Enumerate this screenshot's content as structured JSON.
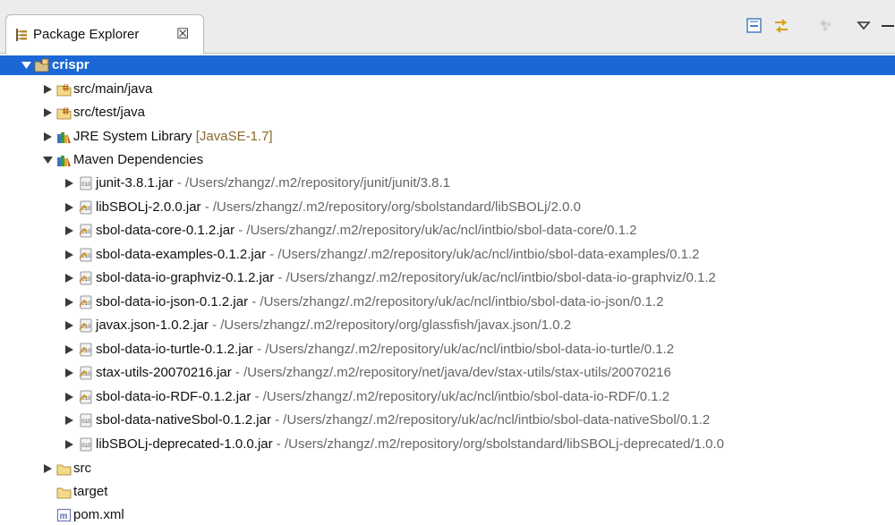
{
  "view": {
    "tab_title": "Package Explorer",
    "close_glyph": "☒"
  },
  "toolbar": {
    "icons": [
      "collapse-all-icon",
      "link-with-editor-icon",
      "focus-icon",
      "view-menu-icon",
      "minimize-icon"
    ]
  },
  "tree": {
    "project": "crispr",
    "src_main": "src/main/java",
    "src_test": "src/test/java",
    "jre_label": "JRE System Library",
    "jre_version": "[JavaSE-1.7]",
    "maven_label": "Maven Dependencies",
    "jars": [
      {
        "name": "junit-3.8.1.jar",
        "path": " - /Users/zhangz/.m2/repository/junit/junit/3.8.1",
        "icon": "binary-jar-icon"
      },
      {
        "name": "libSBOLj-2.0.0.jar",
        "path": " - /Users/zhangz/.m2/repository/org/sbolstandard/libSBOLj/2.0.0",
        "icon": "source-jar-icon"
      },
      {
        "name": "sbol-data-core-0.1.2.jar",
        "path": " - /Users/zhangz/.m2/repository/uk/ac/ncl/intbio/sbol-data-core/0.1.2",
        "icon": "source-jar-icon"
      },
      {
        "name": "sbol-data-examples-0.1.2.jar",
        "path": " - /Users/zhangz/.m2/repository/uk/ac/ncl/intbio/sbol-data-examples/0.1.2",
        "icon": "source-jar-icon"
      },
      {
        "name": "sbol-data-io-graphviz-0.1.2.jar",
        "path": " - /Users/zhangz/.m2/repository/uk/ac/ncl/intbio/sbol-data-io-graphviz/0.1.2",
        "icon": "source-jar-icon"
      },
      {
        "name": "sbol-data-io-json-0.1.2.jar",
        "path": " - /Users/zhangz/.m2/repository/uk/ac/ncl/intbio/sbol-data-io-json/0.1.2",
        "icon": "source-jar-icon"
      },
      {
        "name": "javax.json-1.0.2.jar",
        "path": " - /Users/zhangz/.m2/repository/org/glassfish/javax.json/1.0.2",
        "icon": "source-jar-icon"
      },
      {
        "name": "sbol-data-io-turtle-0.1.2.jar",
        "path": " - /Users/zhangz/.m2/repository/uk/ac/ncl/intbio/sbol-data-io-turtle/0.1.2",
        "icon": "source-jar-icon"
      },
      {
        "name": "stax-utils-20070216.jar",
        "path": " - /Users/zhangz/.m2/repository/net/java/dev/stax-utils/stax-utils/20070216",
        "icon": "source-jar-icon"
      },
      {
        "name": "sbol-data-io-RDF-0.1.2.jar",
        "path": " - /Users/zhangz/.m2/repository/uk/ac/ncl/intbio/sbol-data-io-RDF/0.1.2",
        "icon": "source-jar-icon"
      },
      {
        "name": "sbol-data-nativeSbol-0.1.2.jar",
        "path": " - /Users/zhangz/.m2/repository/uk/ac/ncl/intbio/sbol-data-nativeSbol/0.1.2",
        "icon": "binary-jar-icon"
      },
      {
        "name": "libSBOLj-deprecated-1.0.0.jar",
        "path": " - /Users/zhangz/.m2/repository/org/sbolstandard/libSBOLj-deprecated/1.0.0",
        "icon": "binary-jar-icon"
      }
    ],
    "src_folder": "src",
    "target_folder": "target",
    "pom": "pom.xml"
  },
  "colors": {
    "selection": "#1b67d6",
    "decoration": "#8a6a2e",
    "path_text": "#666666",
    "toolbar_bg": "#ececec"
  }
}
